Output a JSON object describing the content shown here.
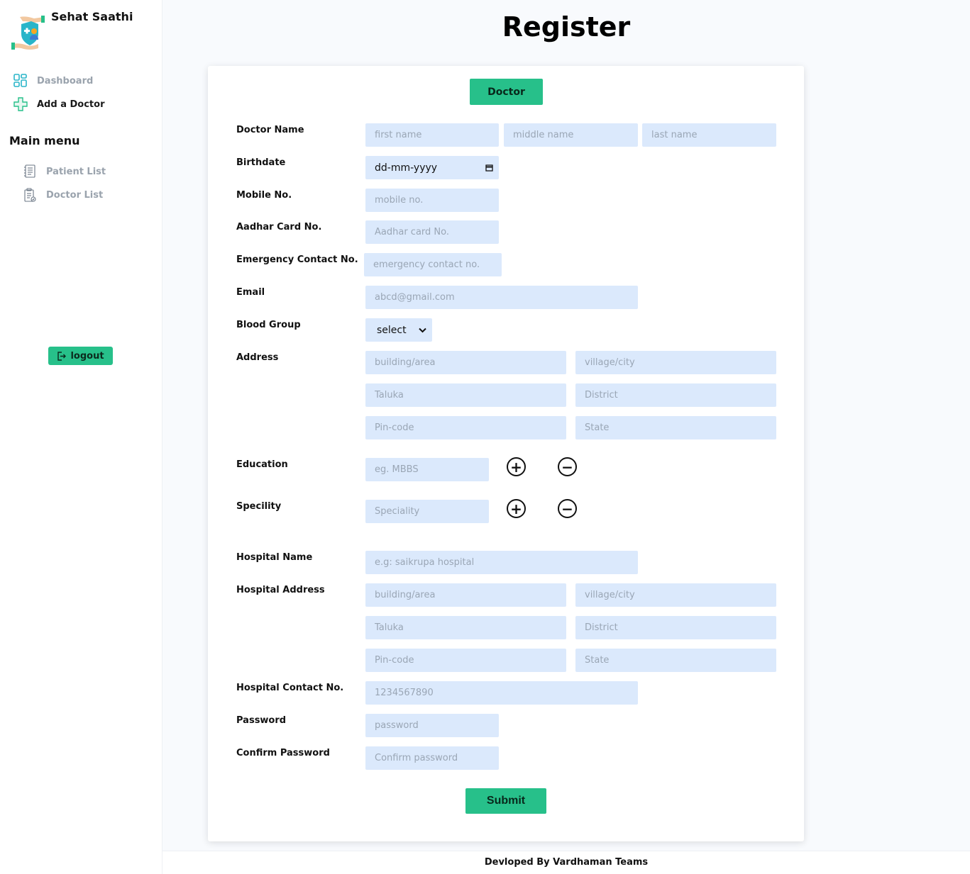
{
  "app": {
    "brand_title": "Sehat Saathi"
  },
  "sidebar": {
    "dashboard_label": "Dashboard",
    "add_doctor_label": "Add a Doctor",
    "main_menu_heading": "Main menu",
    "patient_list_label": "Patient List",
    "doctor_list_label": "Doctor List",
    "logout_label": "logout"
  },
  "page": {
    "title": "Register",
    "role_tab": "Doctor"
  },
  "form": {
    "labels": {
      "doctor_name": "Doctor Name",
      "birthdate": "Birthdate",
      "mobile": "Mobile No.",
      "aadhar": "Aadhar Card No.",
      "emergency": "Emergency Contact No.",
      "email": "Email",
      "blood_group": "Blood Group",
      "address": "Address",
      "education": "Education",
      "speciality": "Specility",
      "hospital_name": "Hospital Name",
      "hospital_address": "Hospital Address",
      "hospital_contact": "Hospital Contact No.",
      "password": "Password",
      "confirm_password": "Confirm Password"
    },
    "placeholders": {
      "first_name": "first name",
      "middle_name": "middle name",
      "last_name": "last name",
      "mobile": "mobile no.",
      "aadhar": "Aadhar card No.",
      "emergency": "emergency contact no.",
      "email": "abcd@gmail.com",
      "building": "building/area",
      "village": "village/city",
      "taluka": "Taluka",
      "district": "District",
      "pincode": "Pin-code",
      "state": "State",
      "education": "eg. MBBS",
      "speciality": "Speciality",
      "hospital_name": "e.g: saikrupa hospital",
      "hospital_contact": "1234567890",
      "password": "password",
      "confirm_password": "Confirm password"
    },
    "birthdate_value": "dd-mm-yyyy",
    "blood_group_selected": "select",
    "add_symbol": "+",
    "remove_symbol": "−",
    "submit_label": "Submit"
  },
  "footer": {
    "text": "Devloped By Vardhaman Teams"
  },
  "colors": {
    "accent": "#27c08a",
    "input_bg": "#dbe9fc"
  }
}
